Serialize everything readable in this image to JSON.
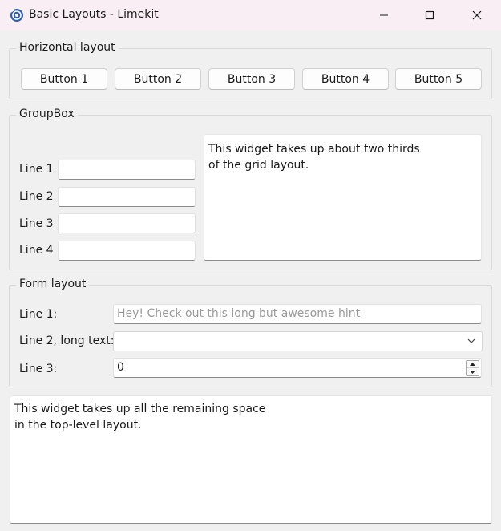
{
  "window": {
    "title": "Basic Layouts - Limekit"
  },
  "horizontal_layout": {
    "title": "Horizontal layout",
    "buttons": [
      "Button 1",
      "Button 2",
      "Button 3",
      "Button 4",
      "Button 5"
    ]
  },
  "group_box": {
    "title": "GroupBox",
    "lines": [
      "Line 1",
      "Line 2",
      "Line 3",
      "Line 4"
    ],
    "text": "This widget takes up about two thirds\nof the grid layout."
  },
  "form_layout": {
    "title": "Form layout",
    "line1_label": "Line 1:",
    "line1_placeholder": "Hey! Check out this long but awesome hint",
    "line2_label": "Line 2, long text:",
    "line2_value": "",
    "line3_label": "Line 3:",
    "line3_value": "0"
  },
  "bottom_text": "This widget takes up all the remaining space\nin the top-level layout."
}
